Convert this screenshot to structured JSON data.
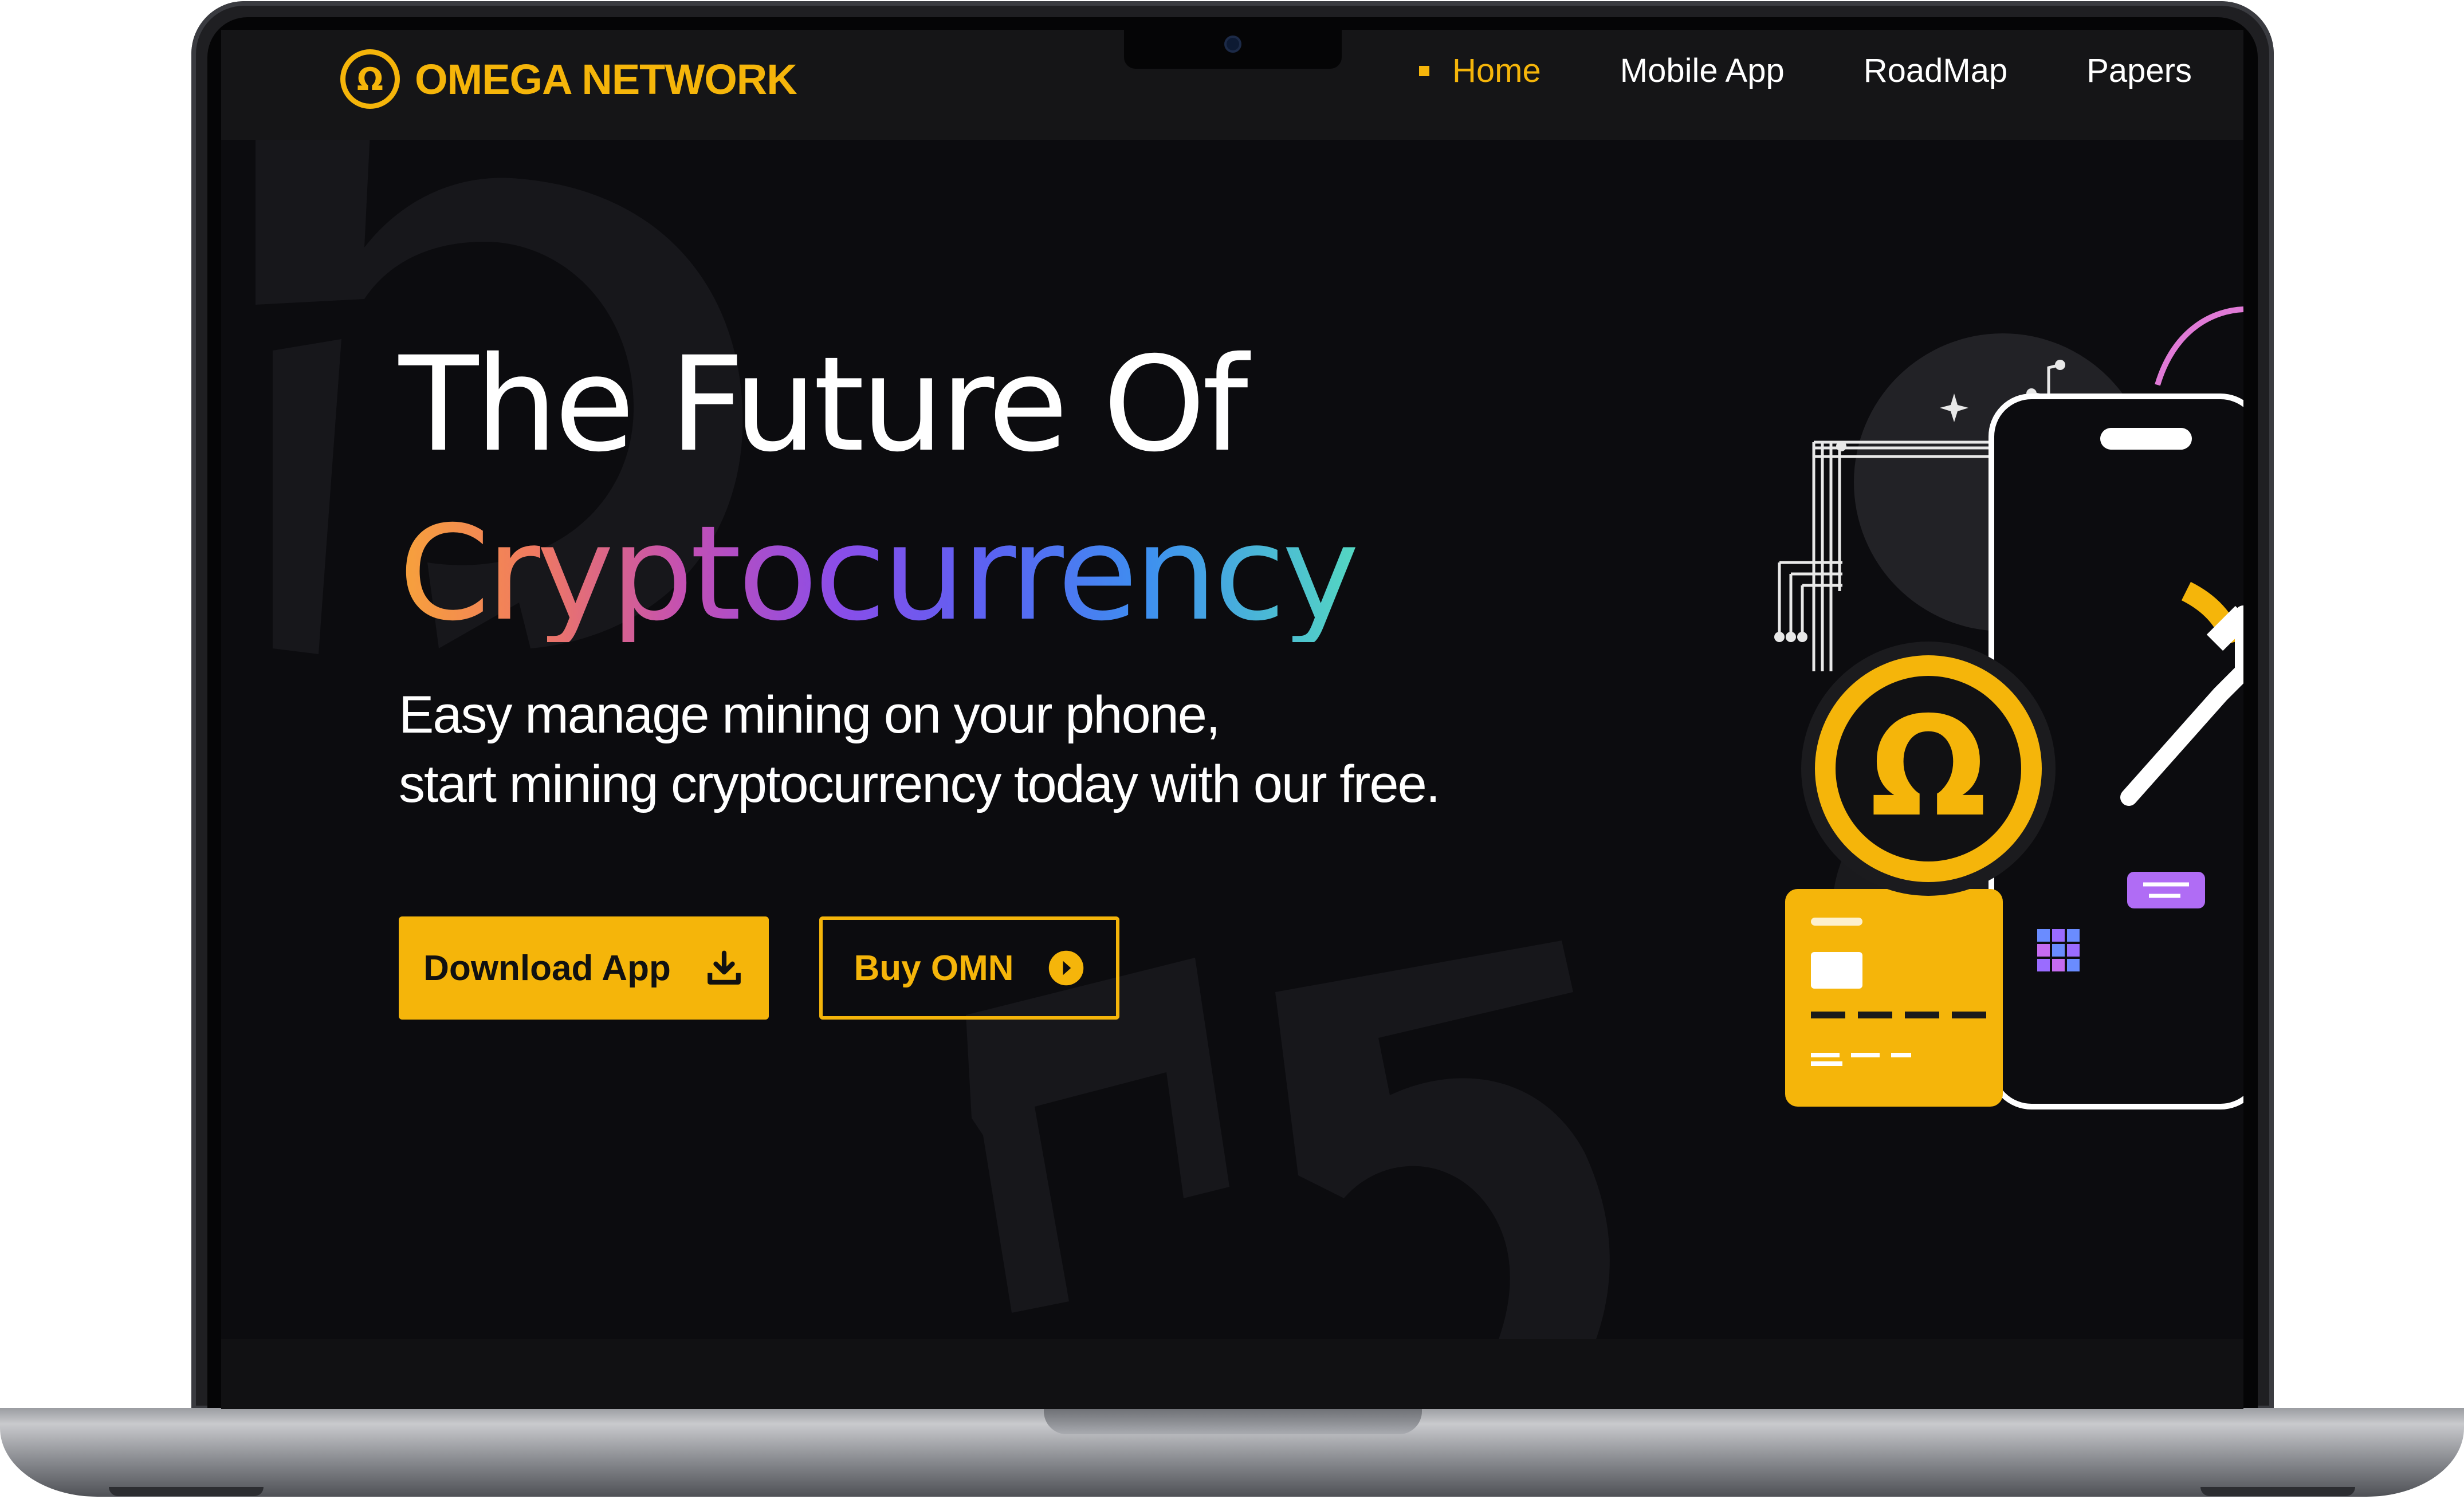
{
  "brand": {
    "name": "OMEGA NETWORK",
    "logo_glyph": "Ω",
    "accent": "#f5b50a"
  },
  "nav": {
    "items": [
      {
        "label": "Home",
        "active": true
      },
      {
        "label": "Mobile App",
        "active": false
      },
      {
        "label": "RoadMap",
        "active": false
      },
      {
        "label": "Papers",
        "active": false
      }
    ]
  },
  "hero": {
    "title_line1": "The Future Of",
    "title_line2": "Cryptocurrency",
    "subtitle_line1": "Easy manage mining on your phone,",
    "subtitle_line2": "start mining cryptocurrency today with our free."
  },
  "buttons": {
    "download_label": "Download App",
    "download_icon": "download-icon",
    "buy_label": "Buy OMN",
    "buy_icon": "arrow-circle-icon"
  },
  "illustration": {
    "coin_glyph": "Ω"
  },
  "colors": {
    "background": "#0c0c0f",
    "header": "#151517",
    "accent": "#f5b50a"
  }
}
